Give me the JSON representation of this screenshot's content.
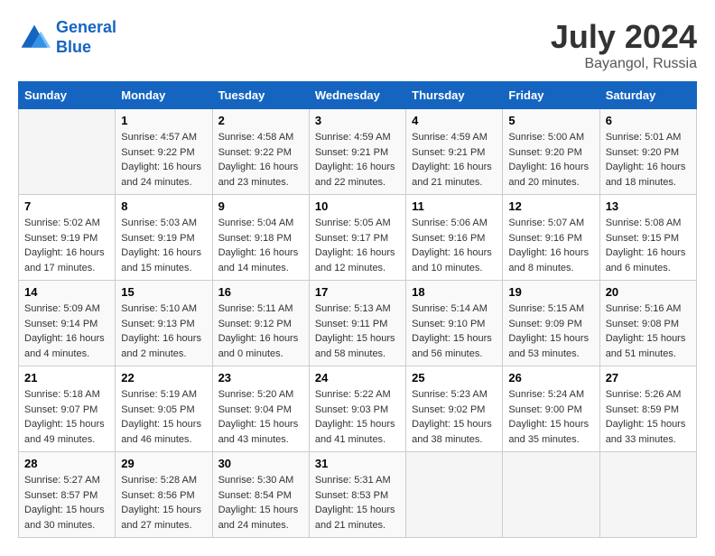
{
  "logo": {
    "line1": "General",
    "line2": "Blue"
  },
  "title": "July 2024",
  "subtitle": "Bayangol, Russia",
  "days_header": [
    "Sunday",
    "Monday",
    "Tuesday",
    "Wednesday",
    "Thursday",
    "Friday",
    "Saturday"
  ],
  "weeks": [
    [
      {
        "day": "",
        "sunrise": "",
        "sunset": "",
        "daylight": ""
      },
      {
        "day": "1",
        "sunrise": "Sunrise: 4:57 AM",
        "sunset": "Sunset: 9:22 PM",
        "daylight": "Daylight: 16 hours and 24 minutes."
      },
      {
        "day": "2",
        "sunrise": "Sunrise: 4:58 AM",
        "sunset": "Sunset: 9:22 PM",
        "daylight": "Daylight: 16 hours and 23 minutes."
      },
      {
        "day": "3",
        "sunrise": "Sunrise: 4:59 AM",
        "sunset": "Sunset: 9:21 PM",
        "daylight": "Daylight: 16 hours and 22 minutes."
      },
      {
        "day": "4",
        "sunrise": "Sunrise: 4:59 AM",
        "sunset": "Sunset: 9:21 PM",
        "daylight": "Daylight: 16 hours and 21 minutes."
      },
      {
        "day": "5",
        "sunrise": "Sunrise: 5:00 AM",
        "sunset": "Sunset: 9:20 PM",
        "daylight": "Daylight: 16 hours and 20 minutes."
      },
      {
        "day": "6",
        "sunrise": "Sunrise: 5:01 AM",
        "sunset": "Sunset: 9:20 PM",
        "daylight": "Daylight: 16 hours and 18 minutes."
      }
    ],
    [
      {
        "day": "7",
        "sunrise": "Sunrise: 5:02 AM",
        "sunset": "Sunset: 9:19 PM",
        "daylight": "Daylight: 16 hours and 17 minutes."
      },
      {
        "day": "8",
        "sunrise": "Sunrise: 5:03 AM",
        "sunset": "Sunset: 9:19 PM",
        "daylight": "Daylight: 16 hours and 15 minutes."
      },
      {
        "day": "9",
        "sunrise": "Sunrise: 5:04 AM",
        "sunset": "Sunset: 9:18 PM",
        "daylight": "Daylight: 16 hours and 14 minutes."
      },
      {
        "day": "10",
        "sunrise": "Sunrise: 5:05 AM",
        "sunset": "Sunset: 9:17 PM",
        "daylight": "Daylight: 16 hours and 12 minutes."
      },
      {
        "day": "11",
        "sunrise": "Sunrise: 5:06 AM",
        "sunset": "Sunset: 9:16 PM",
        "daylight": "Daylight: 16 hours and 10 minutes."
      },
      {
        "day": "12",
        "sunrise": "Sunrise: 5:07 AM",
        "sunset": "Sunset: 9:16 PM",
        "daylight": "Daylight: 16 hours and 8 minutes."
      },
      {
        "day": "13",
        "sunrise": "Sunrise: 5:08 AM",
        "sunset": "Sunset: 9:15 PM",
        "daylight": "Daylight: 16 hours and 6 minutes."
      }
    ],
    [
      {
        "day": "14",
        "sunrise": "Sunrise: 5:09 AM",
        "sunset": "Sunset: 9:14 PM",
        "daylight": "Daylight: 16 hours and 4 minutes."
      },
      {
        "day": "15",
        "sunrise": "Sunrise: 5:10 AM",
        "sunset": "Sunset: 9:13 PM",
        "daylight": "Daylight: 16 hours and 2 minutes."
      },
      {
        "day": "16",
        "sunrise": "Sunrise: 5:11 AM",
        "sunset": "Sunset: 9:12 PM",
        "daylight": "Daylight: 16 hours and 0 minutes."
      },
      {
        "day": "17",
        "sunrise": "Sunrise: 5:13 AM",
        "sunset": "Sunset: 9:11 PM",
        "daylight": "Daylight: 15 hours and 58 minutes."
      },
      {
        "day": "18",
        "sunrise": "Sunrise: 5:14 AM",
        "sunset": "Sunset: 9:10 PM",
        "daylight": "Daylight: 15 hours and 56 minutes."
      },
      {
        "day": "19",
        "sunrise": "Sunrise: 5:15 AM",
        "sunset": "Sunset: 9:09 PM",
        "daylight": "Daylight: 15 hours and 53 minutes."
      },
      {
        "day": "20",
        "sunrise": "Sunrise: 5:16 AM",
        "sunset": "Sunset: 9:08 PM",
        "daylight": "Daylight: 15 hours and 51 minutes."
      }
    ],
    [
      {
        "day": "21",
        "sunrise": "Sunrise: 5:18 AM",
        "sunset": "Sunset: 9:07 PM",
        "daylight": "Daylight: 15 hours and 49 minutes."
      },
      {
        "day": "22",
        "sunrise": "Sunrise: 5:19 AM",
        "sunset": "Sunset: 9:05 PM",
        "daylight": "Daylight: 15 hours and 46 minutes."
      },
      {
        "day": "23",
        "sunrise": "Sunrise: 5:20 AM",
        "sunset": "Sunset: 9:04 PM",
        "daylight": "Daylight: 15 hours and 43 minutes."
      },
      {
        "day": "24",
        "sunrise": "Sunrise: 5:22 AM",
        "sunset": "Sunset: 9:03 PM",
        "daylight": "Daylight: 15 hours and 41 minutes."
      },
      {
        "day": "25",
        "sunrise": "Sunrise: 5:23 AM",
        "sunset": "Sunset: 9:02 PM",
        "daylight": "Daylight: 15 hours and 38 minutes."
      },
      {
        "day": "26",
        "sunrise": "Sunrise: 5:24 AM",
        "sunset": "Sunset: 9:00 PM",
        "daylight": "Daylight: 15 hours and 35 minutes."
      },
      {
        "day": "27",
        "sunrise": "Sunrise: 5:26 AM",
        "sunset": "Sunset: 8:59 PM",
        "daylight": "Daylight: 15 hours and 33 minutes."
      }
    ],
    [
      {
        "day": "28",
        "sunrise": "Sunrise: 5:27 AM",
        "sunset": "Sunset: 8:57 PM",
        "daylight": "Daylight: 15 hours and 30 minutes."
      },
      {
        "day": "29",
        "sunrise": "Sunrise: 5:28 AM",
        "sunset": "Sunset: 8:56 PM",
        "daylight": "Daylight: 15 hours and 27 minutes."
      },
      {
        "day": "30",
        "sunrise": "Sunrise: 5:30 AM",
        "sunset": "Sunset: 8:54 PM",
        "daylight": "Daylight: 15 hours and 24 minutes."
      },
      {
        "day": "31",
        "sunrise": "Sunrise: 5:31 AM",
        "sunset": "Sunset: 8:53 PM",
        "daylight": "Daylight: 15 hours and 21 minutes."
      },
      {
        "day": "",
        "sunrise": "",
        "sunset": "",
        "daylight": ""
      },
      {
        "day": "",
        "sunrise": "",
        "sunset": "",
        "daylight": ""
      },
      {
        "day": "",
        "sunrise": "",
        "sunset": "",
        "daylight": ""
      }
    ]
  ]
}
